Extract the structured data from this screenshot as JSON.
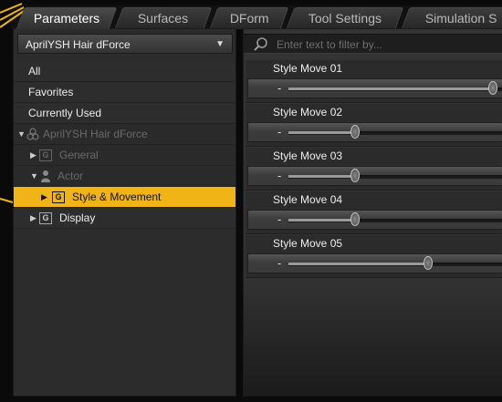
{
  "tabs": [
    {
      "label": "Parameters",
      "active": true
    },
    {
      "label": "Surfaces",
      "active": false
    },
    {
      "label": "DForm",
      "active": false
    },
    {
      "label": "Tool Settings",
      "active": false
    },
    {
      "label": "Simulation S",
      "active": false
    }
  ],
  "left_pane": {
    "figure_selector": {
      "value": "AprilYSH Hair dForce",
      "arrow_icon": "dropdown-triangle-icon"
    },
    "items": [
      {
        "label": "All"
      },
      {
        "label": "Favorites"
      },
      {
        "label": "Currently Used"
      },
      {
        "label": "AprilYSH Hair dForce",
        "icon": "figure-node-icon",
        "expander": "expanded"
      },
      {
        "label": "General",
        "icon": "group-icon",
        "expander": "collapsed"
      },
      {
        "label": "Actor",
        "icon": "actor-icon",
        "expander": "expanded"
      },
      {
        "label": "Style & Movement",
        "icon": "group-icon",
        "expander": "collapsed",
        "selected": true
      },
      {
        "label": "Display",
        "icon": "group-icon",
        "expander": "collapsed"
      }
    ]
  },
  "right_pane": {
    "filter": {
      "placeholder": "Enter text to filter by...",
      "icon": "search-icon"
    },
    "params": [
      {
        "name": "Style Move 01",
        "value_fraction": 0.95
      },
      {
        "name": "Style Move 02",
        "value_fraction": 0.31
      },
      {
        "name": "Style Move 03",
        "value_fraction": 0.31
      },
      {
        "name": "Style Move 04",
        "value_fraction": 0.31
      },
      {
        "name": "Style Move 05",
        "value_fraction": 0.65
      }
    ]
  },
  "colors": {
    "selection": "#f0b417",
    "callout": "#f0b417"
  }
}
